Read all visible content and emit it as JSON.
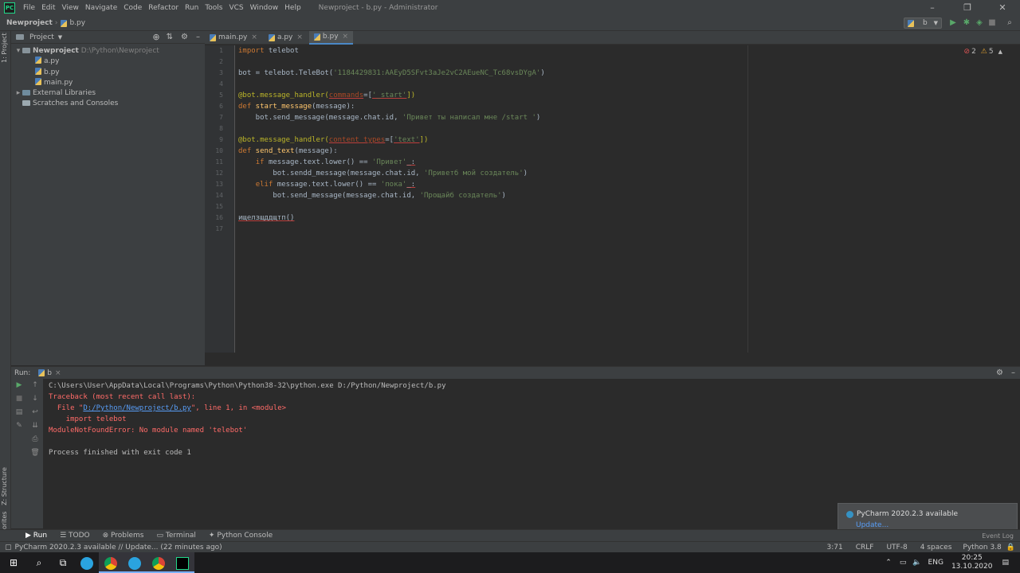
{
  "menubar": {
    "items": [
      "File",
      "Edit",
      "View",
      "Navigate",
      "Code",
      "Refactor",
      "Run",
      "Tools",
      "VCS",
      "Window",
      "Help"
    ],
    "window_title": "Newproject - b.py - Administrator"
  },
  "navbar": {
    "crumbs": [
      "Newproject",
      "b.py"
    ],
    "run_config": "b"
  },
  "project": {
    "title": "Project",
    "root": {
      "name": "Newproject",
      "path": "D:\\Python\\Newproject"
    },
    "files": [
      "a.py",
      "b.py",
      "main.py"
    ],
    "external": "External Libraries",
    "scratches": "Scratches and Consoles"
  },
  "strip": {
    "project": "1: Project",
    "structure": "Z: Structure",
    "favorites": "2: Favorites"
  },
  "tabs": [
    "main.py",
    "a.py",
    "b.py"
  ],
  "editor": {
    "lines": [
      "1",
      "2",
      "3",
      "4",
      "5",
      "6",
      "7",
      "8",
      "9",
      "10",
      "11",
      "12",
      "13",
      "14",
      "15",
      "16",
      "17"
    ],
    "inspection": {
      "errors": "2",
      "warnings": "5"
    },
    "code": {
      "l1_kw": "import",
      "l1_rest": " telebot",
      "l3_a": "bot = telebot.TeleBot(",
      "l3_str": "'1184429831:AAEyD5SFvt3aJe2vC2AEueNC_Tc68vsDYgA'",
      "l3_b": ")",
      "l5_dec": "@bot.message_handler(",
      "l5_par": "commands",
      "l5_eq": "=[",
      "l5_str": "'_start'",
      "l5_end": "])",
      "l6_kw": "def",
      "l6_fn": " start_message",
      "l6_rest": "(message):",
      "l7_a": "    bot.send_message(message.chat.id, ",
      "l7_str": "'Привет ты написал мне /start '",
      "l7_b": ")",
      "l9_dec": "@bot.message_handler(",
      "l9_par": "content_types",
      "l9_eq": "=[",
      "l9_str": "'text'",
      "l9_end": "])",
      "l10_kw": "def",
      "l10_fn": " send_text",
      "l10_rest": "(message):",
      "l11_ind": "    ",
      "l11_kw": "if",
      "l11_a": " message.text.lower() == ",
      "l11_str": "'Привет'",
      "l11_b": "_:",
      "l12_a": "        bot.sendd_message(message.chat.id, ",
      "l12_str": "'Приветб мой создатель'",
      "l12_b": ")",
      "l13_ind": "    ",
      "l13_kw": "elif",
      "l13_a": " message.text.lower() == ",
      "l13_str": "'пока'",
      "l13_b": "_:",
      "l14_a": "        bot.send_message(message.chat.id, ",
      "l14_str": "'Прощайб создатель'",
      "l14_b": ")",
      "l16": "ищелзщддщтп()"
    }
  },
  "run": {
    "label": "Run:",
    "tab": "b",
    "console": {
      "cmd": "C:\\Users\\User\\AppData\\Local\\Programs\\Python\\Python38-32\\python.exe D:/Python/Newproject/b.py",
      "tb": "Traceback (most recent call last):",
      "file_pre": "  File \"",
      "file_link": "D:/Python/Newproject/b.py",
      "file_post": "\", line 1, in <module>",
      "import_line": "    import telebot",
      "error": "ModuleNotFoundError: No module named 'telebot'",
      "finished": "Process finished with exit code 1"
    }
  },
  "bottom_tabs": [
    "Run",
    "TODO",
    "Problems",
    "Terminal",
    "Python Console"
  ],
  "event_log": "Event Log",
  "notification": {
    "title": "PyCharm 2020.2.3 available",
    "link": "Update..."
  },
  "status": {
    "message": "PyCharm 2020.2.3 available // Update... (22 minutes ago)",
    "position": "3:71",
    "line_sep": "CRLF",
    "encoding": "UTF-8",
    "indent": "4 spaces",
    "interpreter": "Python 3.8"
  },
  "taskbar": {
    "lang": "ENG",
    "time": "20:25",
    "date": "13.10.2020"
  }
}
